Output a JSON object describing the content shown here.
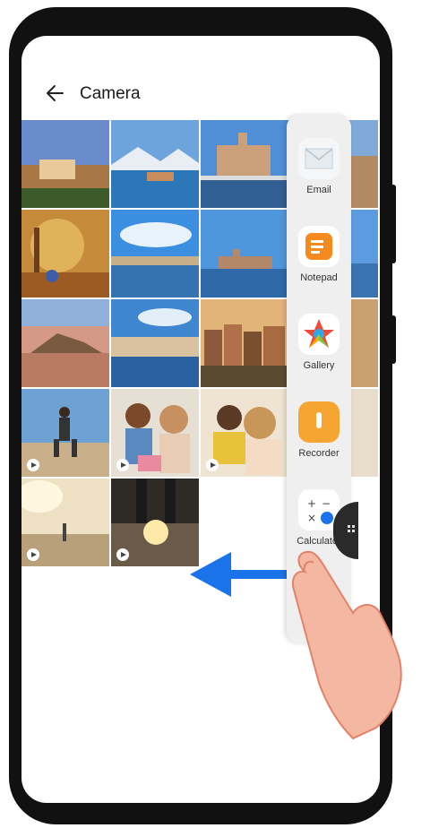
{
  "header": {
    "title": "Camera"
  },
  "gallery": {
    "tiles": [
      {
        "kind": "photo"
      },
      {
        "kind": "photo"
      },
      {
        "kind": "photo"
      },
      {
        "kind": "photo"
      },
      {
        "kind": "photo"
      },
      {
        "kind": "photo"
      },
      {
        "kind": "photo"
      },
      {
        "kind": "photo"
      },
      {
        "kind": "photo"
      },
      {
        "kind": "photo"
      },
      {
        "kind": "photo"
      },
      {
        "kind": "photo"
      },
      {
        "kind": "video"
      },
      {
        "kind": "video"
      },
      {
        "kind": "video"
      },
      {
        "kind": "video"
      },
      {
        "kind": "video"
      },
      {
        "kind": "video"
      }
    ]
  },
  "dock": {
    "apps": [
      {
        "name": "Email",
        "icon": "email-icon"
      },
      {
        "name": "Notepad",
        "icon": "notepad-icon"
      },
      {
        "name": "Gallery",
        "icon": "gallery-icon"
      },
      {
        "name": "Recorder",
        "icon": "recorder-icon"
      },
      {
        "name": "Calculator",
        "icon": "calculator-icon"
      }
    ]
  },
  "colors": {
    "accent_arrow": "#1a73e8",
    "dock_bg": "#efefef"
  }
}
